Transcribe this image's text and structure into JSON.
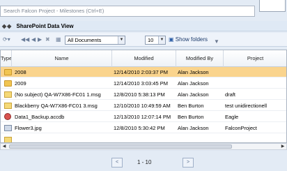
{
  "search": {
    "placeholder": "Search Falcon Project - Milestones (Ctrl+E)"
  },
  "panel": {
    "title": "SharePoint Data View"
  },
  "toolbar": {
    "view_select": "All Documents",
    "page_size": "10",
    "show_folders": "Show folders"
  },
  "grid": {
    "columns": [
      "Type",
      "Name",
      "Modified",
      "Modified By",
      "Project"
    ],
    "rows": [
      {
        "icon": "folder-icon",
        "name": "2008",
        "modified": "12/14/2010 2:03:37 PM",
        "modified_by": "Alan Jackson",
        "project": "",
        "selected": true
      },
      {
        "icon": "folder-icon",
        "name": "2009",
        "modified": "12/14/2010 3:03:45 PM",
        "modified_by": "Alan Jackson",
        "project": ""
      },
      {
        "icon": "email-message-icon",
        "name": "(No subject) QA-W7X86-FC01 1.msg",
        "modified": "12/8/2010 5:38:13 PM",
        "modified_by": "Alan Jackson",
        "project": "draft"
      },
      {
        "icon": "email-message-icon",
        "name": "Blackberry QA-W7X86-FC01 3.msg",
        "modified": "12/10/2010 10:49:59 AM",
        "modified_by": "Ben Burton",
        "project": "test unidirectionell"
      },
      {
        "icon": "access-database-icon",
        "name": "Data1_Backup.accdb",
        "modified": "12/13/2010 12:07:14 PM",
        "modified_by": "Ben Burton",
        "project": "Eagle"
      },
      {
        "icon": "image-file-icon",
        "name": "Flower3.jpg",
        "modified": "12/8/2010 5:30:42 PM",
        "modified_by": "Alan Jackson",
        "project": "FalconProject"
      }
    ]
  },
  "pager": {
    "label": "1 - 10",
    "prev_icon": "chevron-left-icon",
    "next_icon": "chevron-right-icon"
  }
}
